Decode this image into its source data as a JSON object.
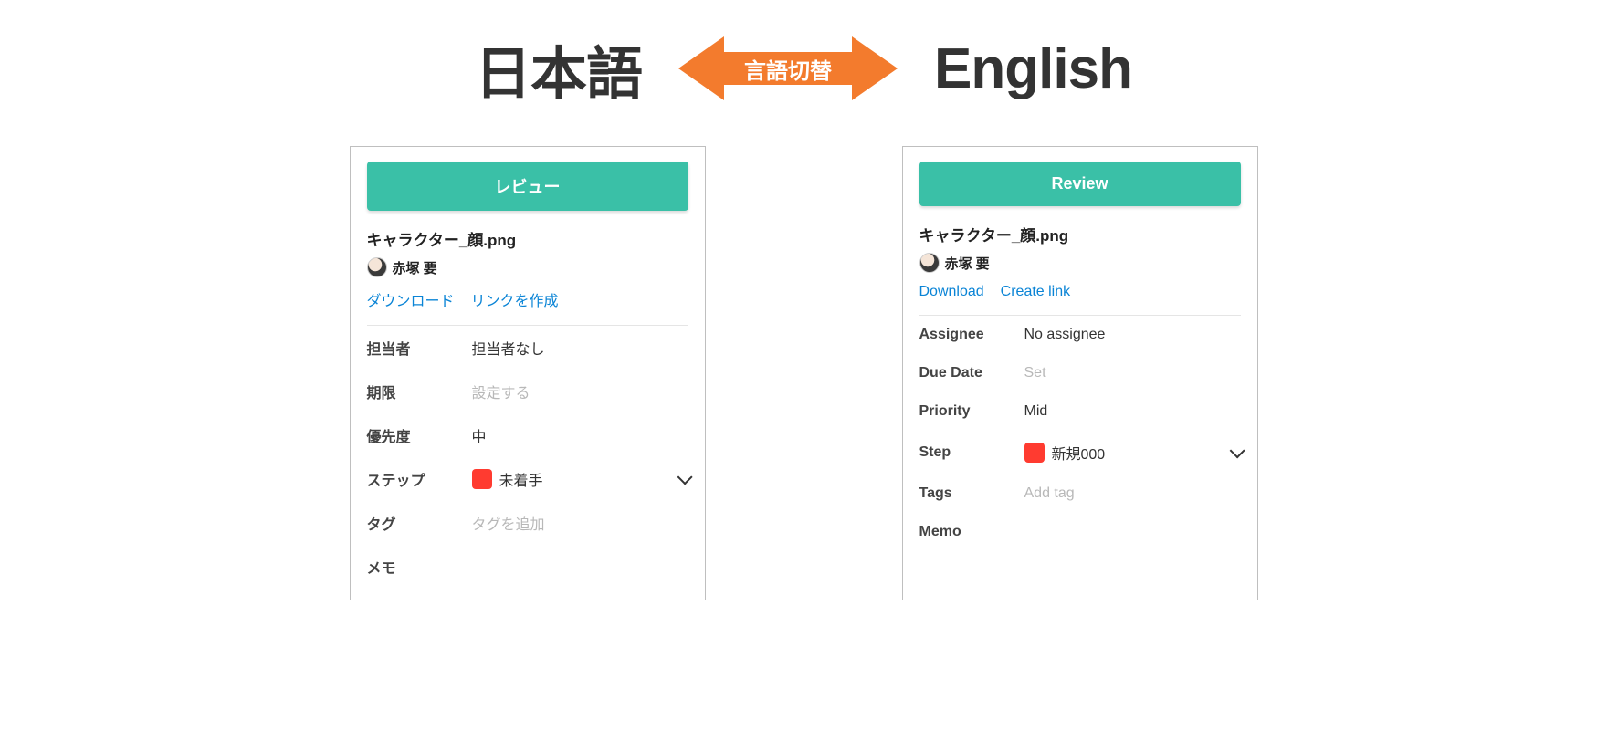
{
  "header": {
    "left_title": "日本語",
    "arrow_label": "言語切替",
    "right_title": "English"
  },
  "jp": {
    "review_button": "レビュー",
    "filename": "キャラクター_顔.png",
    "owner": "赤塚 要",
    "download": "ダウンロード",
    "create_link": "リンクを作成",
    "fields": {
      "assignee_label": "担当者",
      "assignee_value": "担当者なし",
      "due_label": "期限",
      "due_value": "設定する",
      "priority_label": "優先度",
      "priority_value": "中",
      "step_label": "ステップ",
      "step_value": "未着手",
      "tags_label": "タグ",
      "tags_value": "タグを追加",
      "memo_label": "メモ"
    }
  },
  "en": {
    "review_button": "Review",
    "filename": "キャラクター_顔.png",
    "owner": "赤塚 要",
    "download": "Download",
    "create_link": "Create link",
    "fields": {
      "assignee_label": "Assignee",
      "assignee_value": "No assignee",
      "due_label": "Due Date",
      "due_value": "Set",
      "priority_label": "Priority",
      "priority_value": "Mid",
      "step_label": "Step",
      "step_value": "新規000",
      "tags_label": "Tags",
      "tags_value": "Add tag",
      "memo_label": "Memo"
    }
  }
}
